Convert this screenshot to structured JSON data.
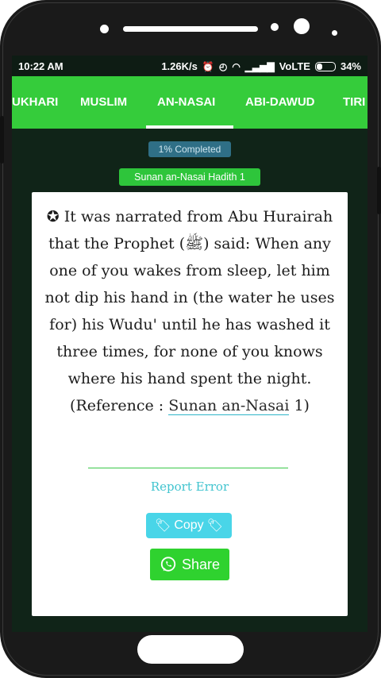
{
  "status_bar": {
    "time": "10:22 AM",
    "speed": "1.26K/s",
    "network": "VoLTE",
    "battery": "34%"
  },
  "tabs": [
    "UKHARI",
    "MUSLIM",
    "AN-NASAI",
    "ABI-DAWUD",
    "TIRI"
  ],
  "selected_tab": "AN-NASAI",
  "progress_label": "1% Completed",
  "progress_fraction": 0.01,
  "hadith_title": "Sunan an-Nasai Hadith 1",
  "hadith": {
    "star": "✪",
    "text": "It was narrated from Abu Hurairah that the Prophet (ﷺ) said: When any one of you wakes from sleep, let him not dip his hand in (the water he uses for) his Wudu' until he has washed it three times, for none of you knows where his hand spent the night.",
    "ref_prefix": "(Reference : ",
    "ref_link": "Sunan an-Nasai",
    "ref_suffix": " 1)"
  },
  "report_error": "Report Error",
  "copy_label": "Copy",
  "share_label": "Share",
  "colors": {
    "accent_green": "#35cc3b",
    "copy_cyan": "#49d5e8",
    "progress_blue": "#2f6f86",
    "screen_bg": "#102418"
  },
  "icons": [
    "alarm-off-icon",
    "alarm-clock-icon",
    "wifi-icon",
    "signal-icon",
    "battery-icon",
    "tag-icon",
    "whatsapp-icon"
  ]
}
